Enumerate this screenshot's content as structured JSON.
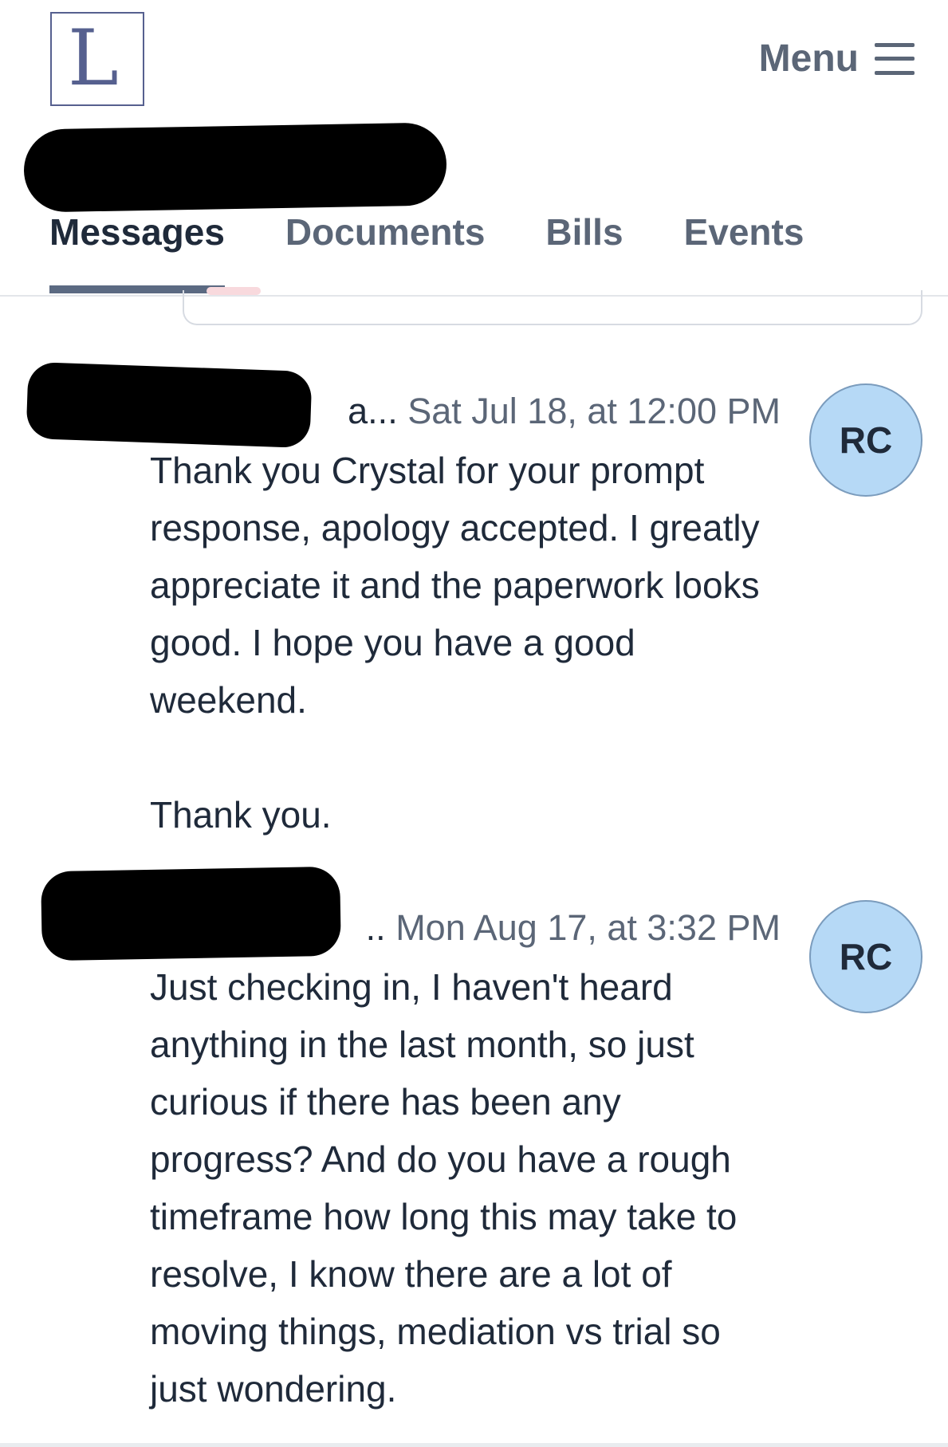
{
  "header": {
    "logo_letter": "L",
    "menu_label": "Menu",
    "menu_icon": "hamburger-icon"
  },
  "tabs": [
    {
      "label": "Messages",
      "active": true
    },
    {
      "label": "Documents",
      "active": false
    },
    {
      "label": "Bills",
      "active": false
    },
    {
      "label": "Events",
      "active": false
    }
  ],
  "messages": [
    {
      "sender_tail": "a...",
      "timestamp": "Sat Jul 18, at 12:00 PM",
      "avatar_initials": "RC",
      "body": "Thank you Crystal for your prompt response, apology accepted. I greatly appreciate it and the paperwork looks good. I hope you have a good weekend.\n\nThank you."
    },
    {
      "sender_tail": "..",
      "timestamp": "Mon Aug 17, at 3:32 PM",
      "avatar_initials": "RC",
      "body": "Just checking in, I haven't heard anything in the last month, so just curious if there has been any progress? And do you have a rough timeframe how long this may take to resolve, I know there are a lot of moving things, mediation vs trial so just wondering."
    }
  ],
  "colors": {
    "accent": "#56608f",
    "avatar_bg": "#b6d9f6",
    "text": "#1f2a3a",
    "muted": "#5b6677"
  }
}
